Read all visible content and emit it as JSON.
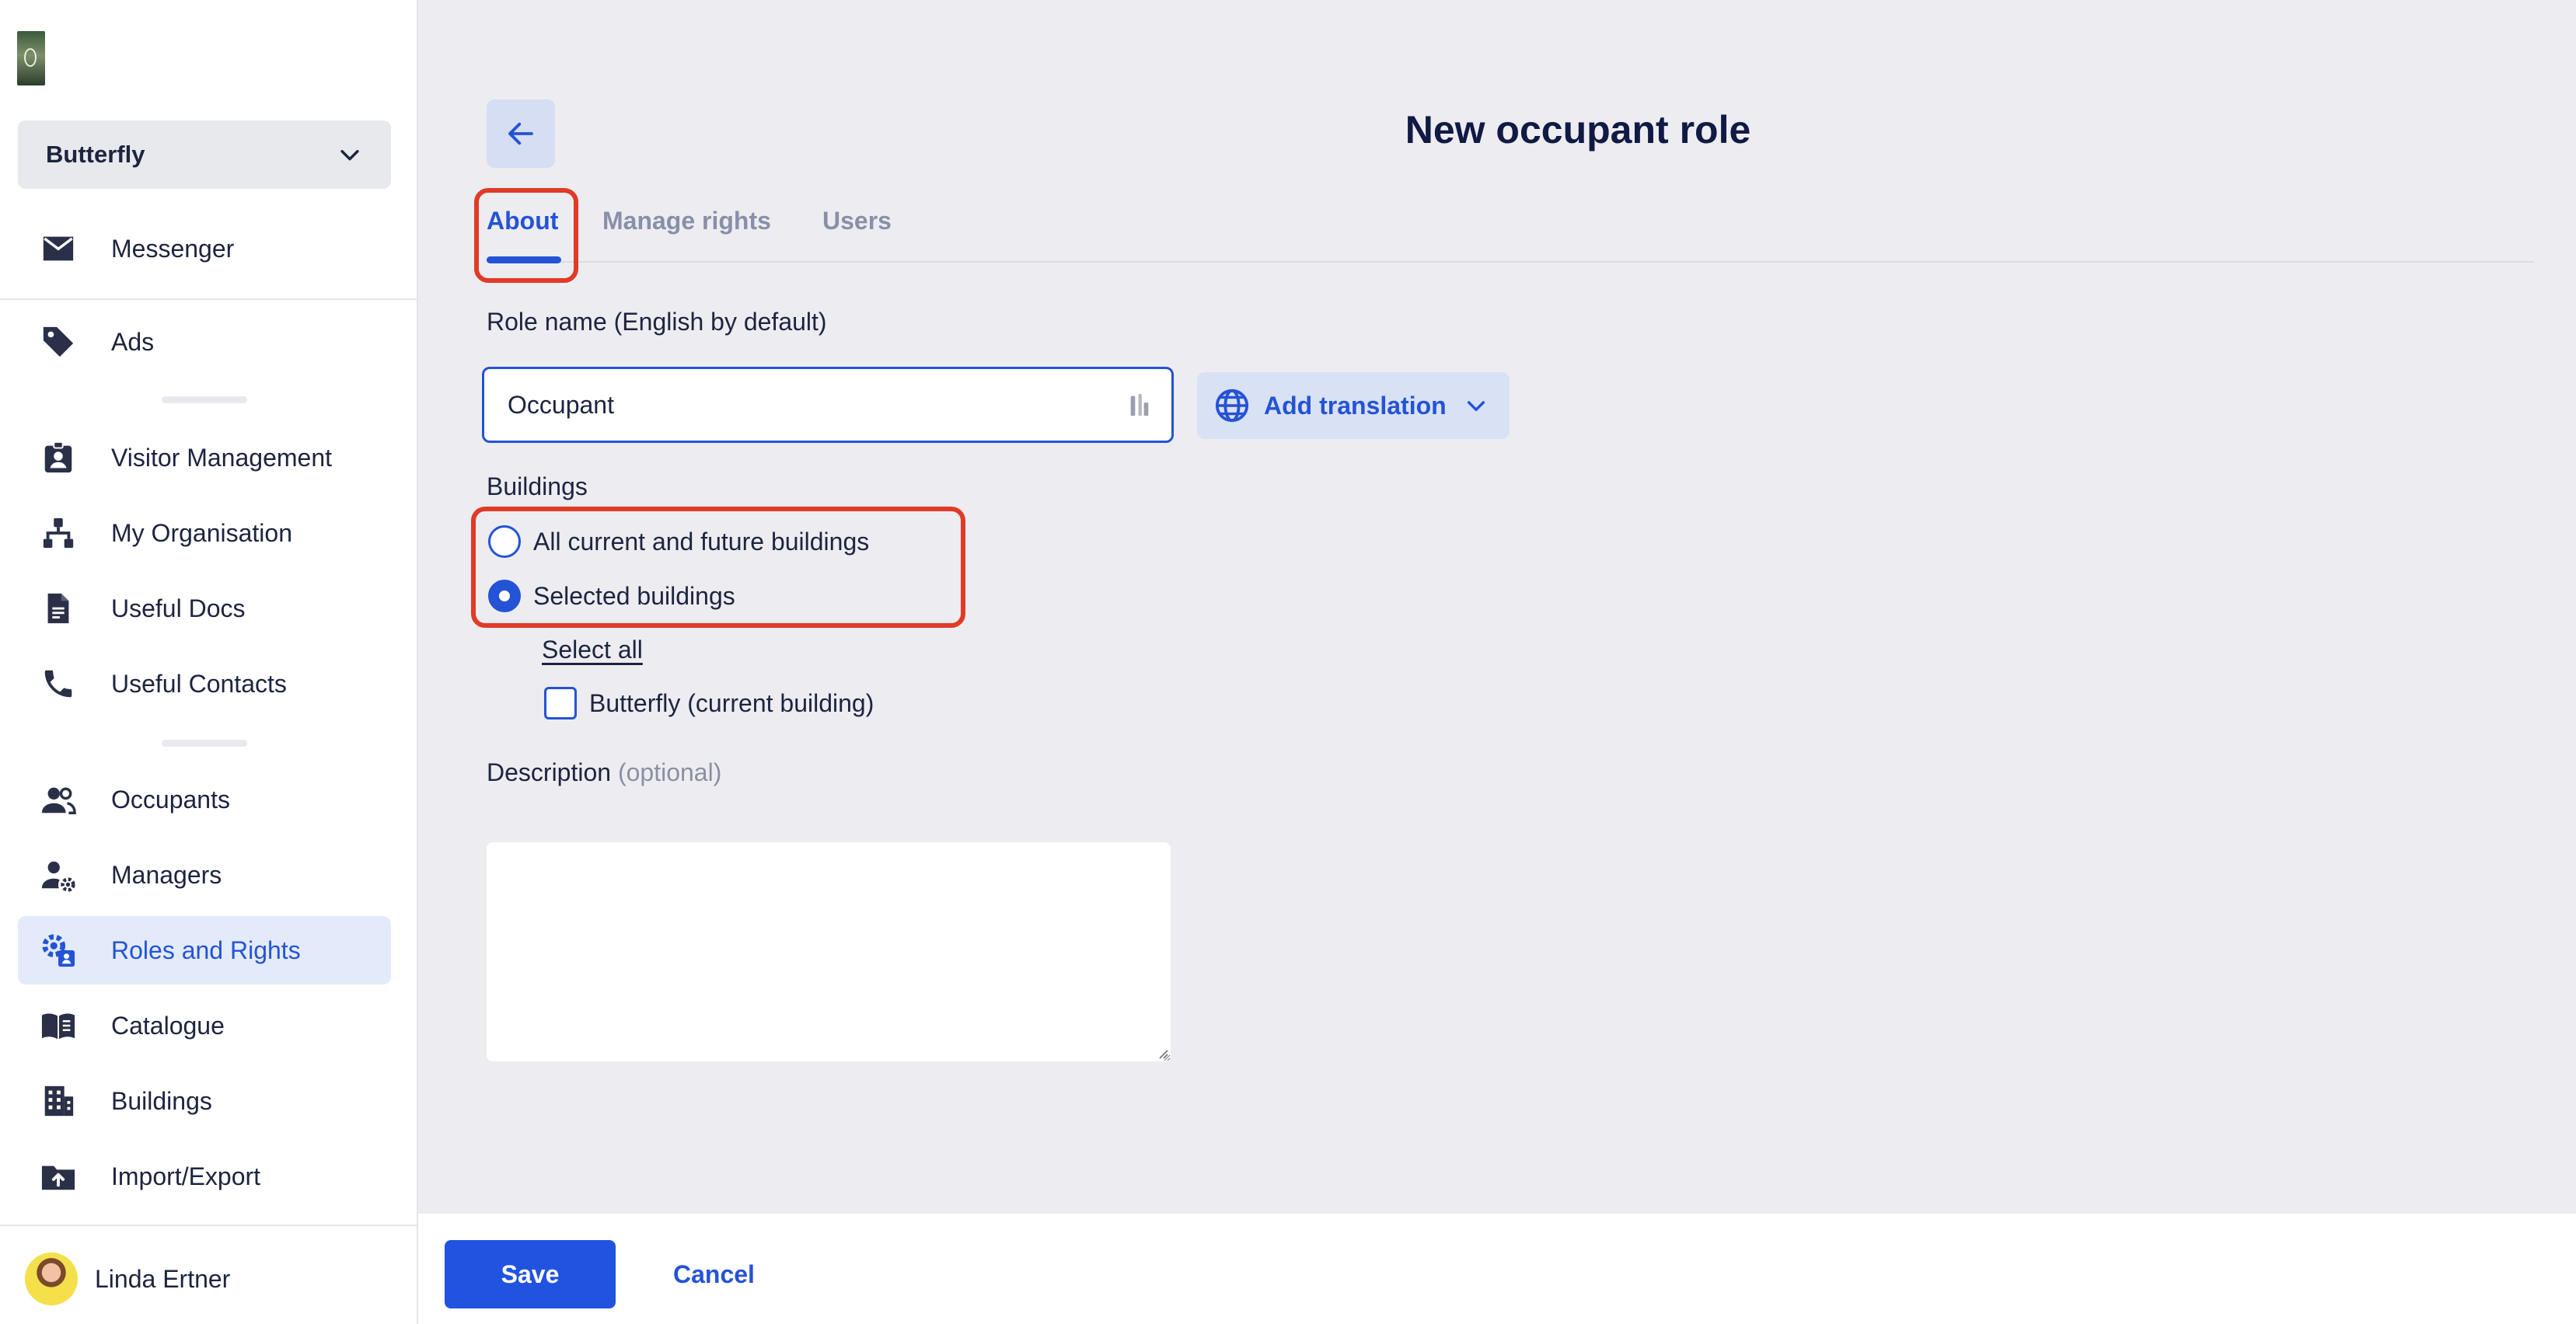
{
  "sidebar": {
    "building": "Butterfly",
    "items": [
      {
        "label": "Messenger",
        "icon": "envelope-icon"
      },
      {
        "label": "Ads",
        "icon": "tag-icon"
      },
      {
        "label": "Visitor Management",
        "icon": "badge-icon"
      },
      {
        "label": "My Organisation",
        "icon": "org-chart-icon"
      },
      {
        "label": "Useful Docs",
        "icon": "document-icon"
      },
      {
        "label": "Useful Contacts",
        "icon": "phone-icon"
      },
      {
        "label": "Occupants",
        "icon": "users-icon"
      },
      {
        "label": "Managers",
        "icon": "user-gear-icon"
      },
      {
        "label": "Roles and Rights",
        "icon": "roles-gear-icon",
        "active": true
      },
      {
        "label": "Catalogue",
        "icon": "book-icon"
      },
      {
        "label": "Buildings",
        "icon": "building-icon"
      },
      {
        "label": "Import/Export",
        "icon": "folder-upload-icon"
      }
    ],
    "user": {
      "name": "Linda Ertner"
    }
  },
  "main": {
    "title": "New occupant role",
    "tabs": [
      {
        "label": "About",
        "active": true
      },
      {
        "label": "Manage rights"
      },
      {
        "label": "Users"
      }
    ],
    "role_name": {
      "label": "Role name (English by default)",
      "value": "Occupant",
      "add_translation": "Add translation"
    },
    "buildings": {
      "label": "Buildings",
      "options": [
        {
          "label": "All current and future buildings",
          "selected": false
        },
        {
          "label": "Selected buildings",
          "selected": true
        }
      ],
      "select_all": "Select all",
      "list": [
        {
          "label": "Butterfly (current building)",
          "checked": false
        }
      ]
    },
    "description": {
      "label": "Description",
      "optional": "(optional)",
      "value": ""
    }
  },
  "footer": {
    "save": "Save",
    "cancel": "Cancel"
  },
  "colors": {
    "accent": "#2553d6",
    "highlight": "#e13a26",
    "background": "#ededf1"
  }
}
